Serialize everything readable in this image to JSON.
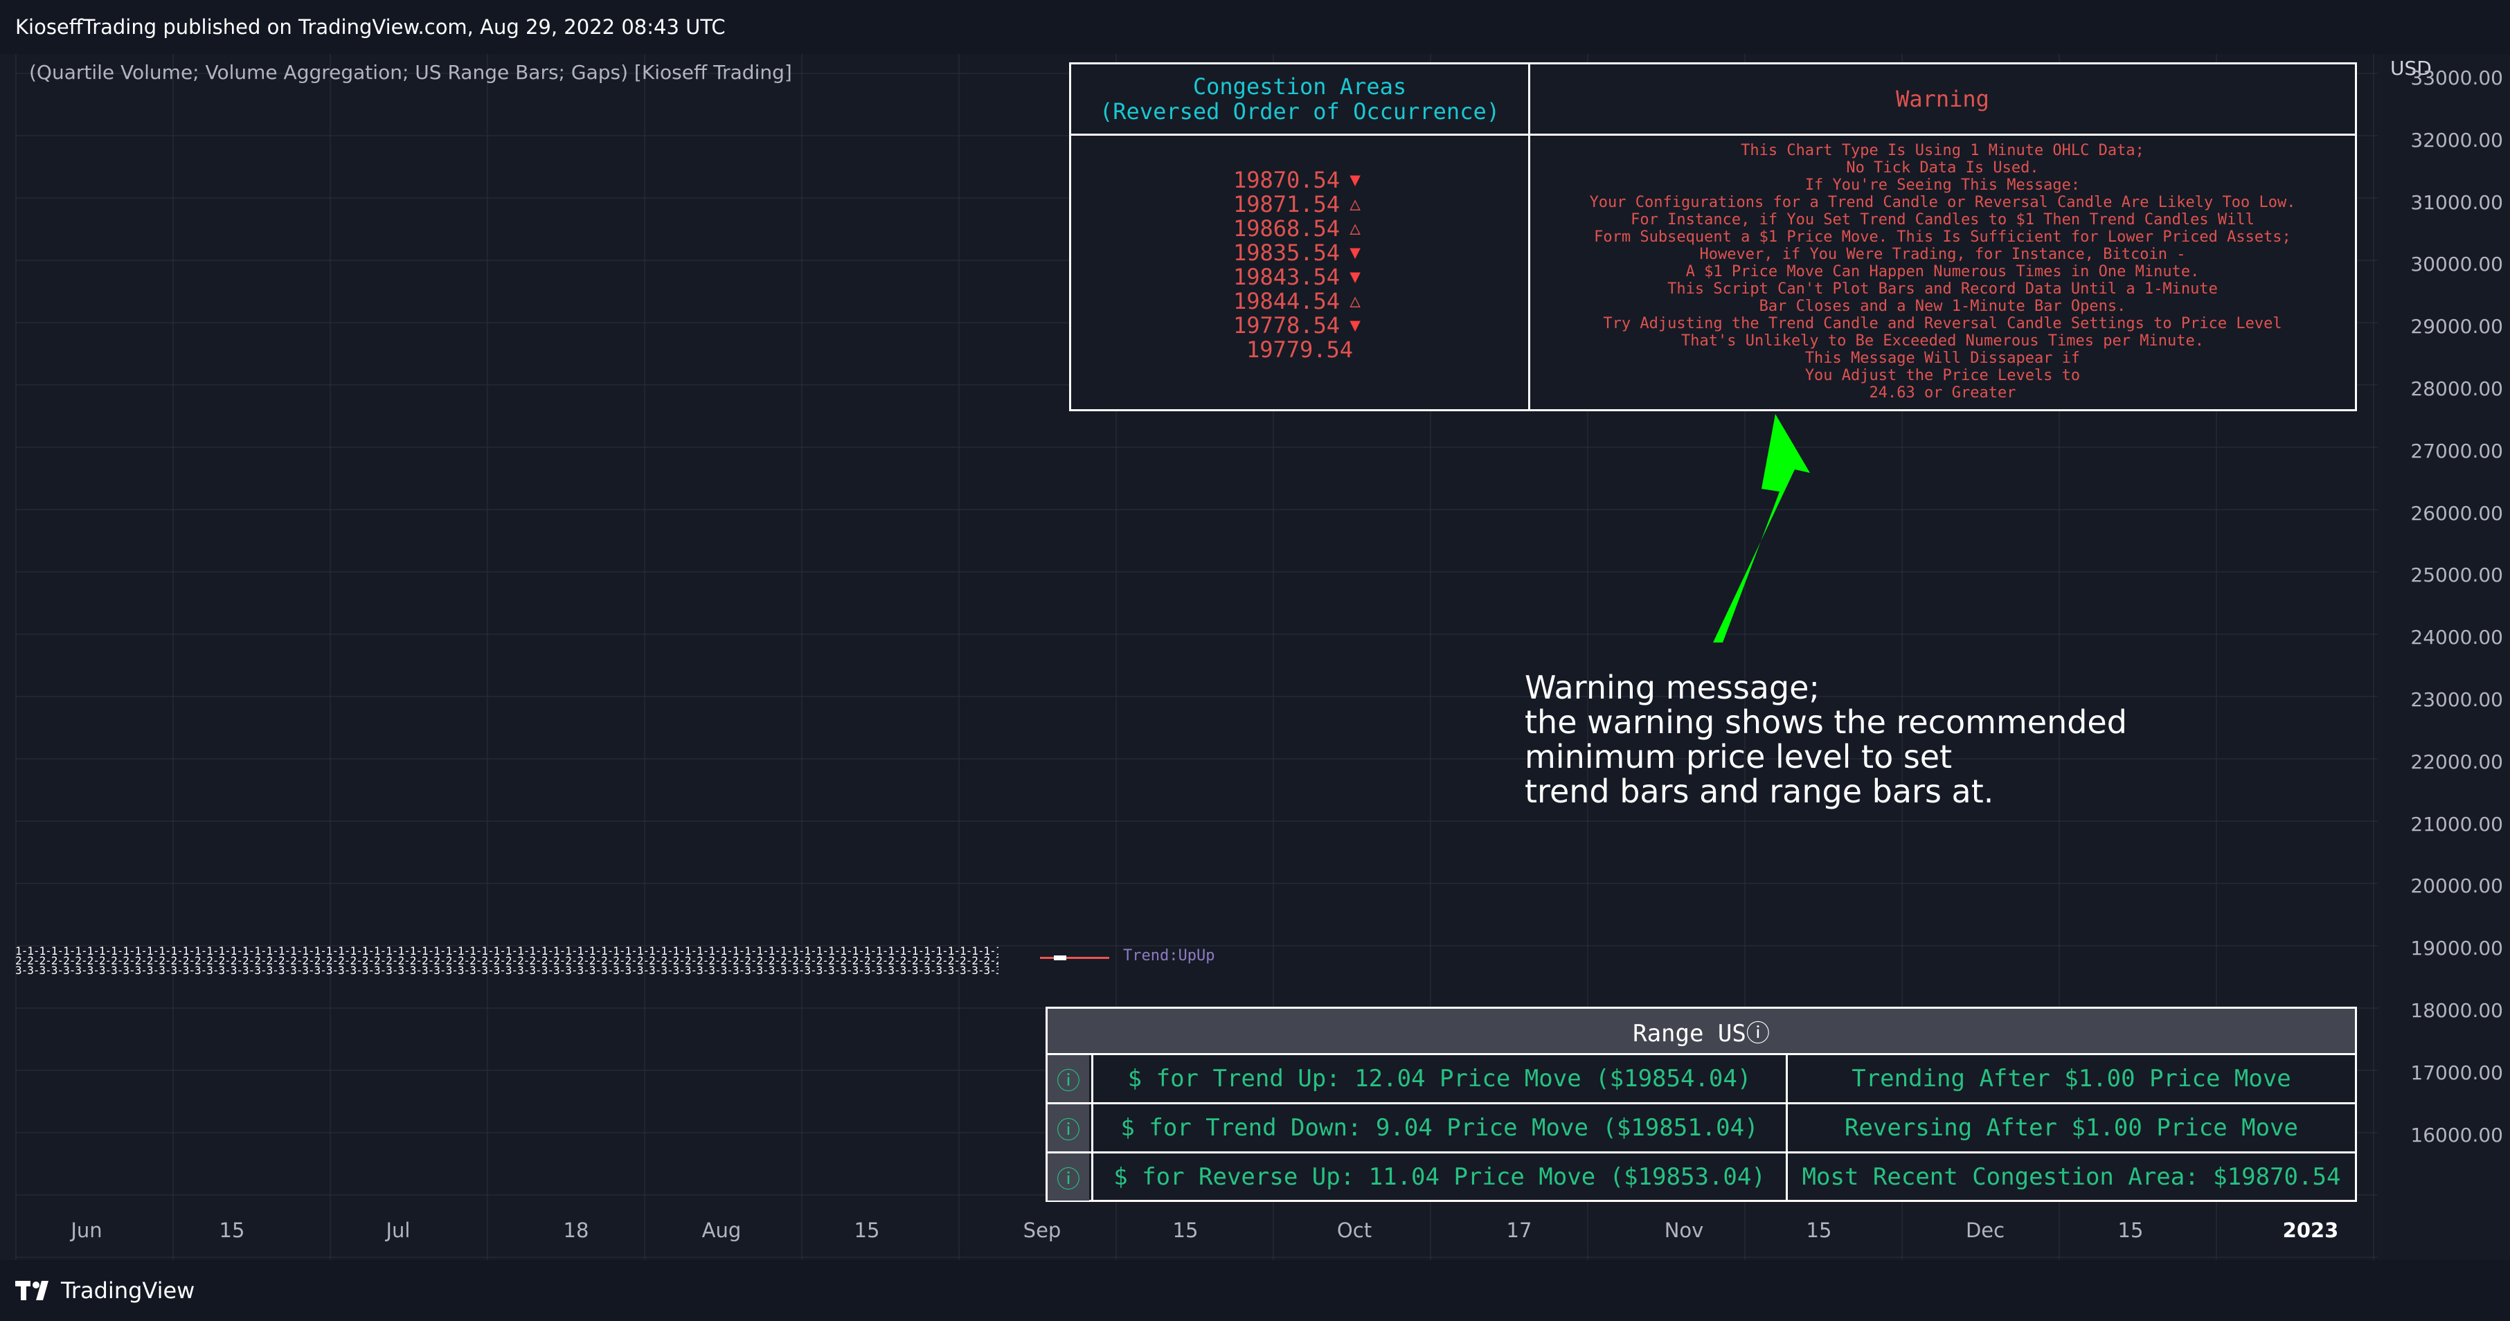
{
  "header": {
    "publisher_line": "KioseffTrading published on TradingView.com, Aug 29, 2022 08:43 UTC"
  },
  "indicator": {
    "label": "(Quartile Volume; Volume Aggregation; US Range Bars; Gaps) [Kioseff Trading]"
  },
  "congestion_table": {
    "left_title_1": "Congestion Areas",
    "left_title_2": "(Reversed Order of Occurrence)",
    "right_title": "Warning",
    "levels": [
      {
        "price": "19870.54",
        "arrow": "▼",
        "dir": "down"
      },
      {
        "price": "19871.54",
        "arrow": "△",
        "dir": "up"
      },
      {
        "price": "19868.54",
        "arrow": "△",
        "dir": "up"
      },
      {
        "price": "19835.54",
        "arrow": "▼",
        "dir": "down"
      },
      {
        "price": "19843.54",
        "arrow": "▼",
        "dir": "down"
      },
      {
        "price": "19844.54",
        "arrow": "△",
        "dir": "up"
      },
      {
        "price": "19778.54",
        "arrow": "▼",
        "dir": "down"
      },
      {
        "price": "19779.54",
        "arrow": "",
        "dir": "none"
      }
    ],
    "warning_lines": [
      "This Chart Type Is Using 1 Minute OHLC Data;",
      "No Tick Data Is Used.",
      "If You're Seeing This Message:",
      "Your Configurations for a Trend Candle or Reversal Candle Are Likely Too Low.",
      "For Instance, if You Set Trend Candles to $1 Then Trend Candles Will",
      "Form Subsequent a $1 Price Move. This Is Sufficient for Lower Priced Assets;",
      "However, if You Were Trading, for Instance, Bitcoin -",
      "A $1 Price Move Can Happen Numerous Times in One Minute.",
      "This Script Can't Plot Bars and Record Data Until a 1-Minute",
      "Bar Closes and a New 1-Minute Bar Opens.",
      "Try Adjusting the Trend Candle and Reversal Candle Settings to Price Level",
      "That's Unlikely to Be Exceeded Numerous Times per Minute.",
      "This Message Will Dissapear if",
      "You Adjust the Price Levels to",
      "24.63 or Greater"
    ]
  },
  "annotation": {
    "lines": [
      "Warning message;",
      "the warning shows the recommended",
      "minimum price level to set",
      "trend bars and range bars at."
    ],
    "arrow_color": "#00ff00"
  },
  "band": {
    "row1": "1-1-1-1-1-1-1-1-1-1-1-1-1-1-1-1-1-1-1-1-1-1-1-1-1-1-1-1-1-1-1-1-1-1-1-1-1-1-1-1-1-1-1-1-1-1-1-1-1-1-1-1-1-1-1-1-1-1-1-1-1-1-1-1-1-1-1-1-1-1-1-1-1-1-1-1-1-1-1-1-1-1-1-1-1-1-1-1-1-1-1-1-1-1-1-1-1-1-1-1",
    "row2": "2-2-2-2-2-2-2-2-2-2-2-2-2-2-2-2-2-2-2-2-2-2-2-2-2-2-2-2-2-2-2-2-2-2-2-2-2-2-2-2-2-2-2-2-2-2-2-2-2-2-2-2-2-2-2-2-2-2-2-2-2-2-2-2-2-2-2-2-2-2-2-2-2-2-2-2-2-2-2-2-2-2-2-2-2-2-2-2-2-2-2-2-2-2-2-2-2-2-2-2",
    "row3": "3-3-3-3-3-3-3-3-3-3-3-3-3-3-3-3-3-3-3-3-3-3-3-3-3-3-3-3-3-3-3-3-3-3-3-3-3-3-3-3-3-3-3-3-3-3-3-3-3-3-3-3-3-3-3-3-3-3-3-3-3-3-3-3-3-3-3-3-3-3-3-3-3-3-3-3-3-3-3-3-3-3-3-3-3-3-3-3-3-3-3-3-3-3-3-3-3-3-3-3",
    "trend_label": "Trend:UpUp"
  },
  "range_table": {
    "title": "Range USⓘ",
    "rows": [
      {
        "icon": "ⓘ",
        "left": "$ for Trend Up: 12.04 Price Move ($19854.04)",
        "right": "Trending After $1.00 Price Move"
      },
      {
        "icon": "ⓘ",
        "left": "$ for Trend Down: 9.04 Price Move ($19851.04)",
        "right": "Reversing After $1.00 Price Move"
      },
      {
        "icon": "ⓘ",
        "left": "$ for Reverse Up: 11.04 Price Move ($19853.04)",
        "right": "Most Recent Congestion Area: $19870.54"
      }
    ]
  },
  "price_axis": {
    "unit": "USD",
    "ticks": [
      "33000.00",
      "32000.00",
      "31000.00",
      "30000.00",
      "29000.00",
      "28000.00",
      "27000.00",
      "26000.00",
      "25000.00",
      "24000.00",
      "23000.00",
      "22000.00",
      "21000.00",
      "20000.00",
      "19000.00",
      "18000.00",
      "17000.00",
      "16000.00"
    ]
  },
  "time_axis": {
    "ticks": [
      {
        "label": "Jun",
        "bold": false
      },
      {
        "label": "15",
        "bold": false
      },
      {
        "label": "Jul",
        "bold": false
      },
      {
        "label": "18",
        "bold": false
      },
      {
        "label": "Aug",
        "bold": false
      },
      {
        "label": "15",
        "bold": false
      },
      {
        "label": "Sep",
        "bold": false
      },
      {
        "label": "15",
        "bold": false
      },
      {
        "label": "Oct",
        "bold": false
      },
      {
        "label": "17",
        "bold": false
      },
      {
        "label": "Nov",
        "bold": false
      },
      {
        "label": "15",
        "bold": false
      },
      {
        "label": "Dec",
        "bold": false
      },
      {
        "label": "15",
        "bold": false
      },
      {
        "label": "2023",
        "bold": true
      }
    ]
  },
  "footer": {
    "brand": "TradingView"
  },
  "colors": {
    "background": "#131722",
    "cyan": "#19c8d2",
    "red": "#e0534f",
    "green_text": "#26c281",
    "annotation_arrow": "#00ff00"
  }
}
